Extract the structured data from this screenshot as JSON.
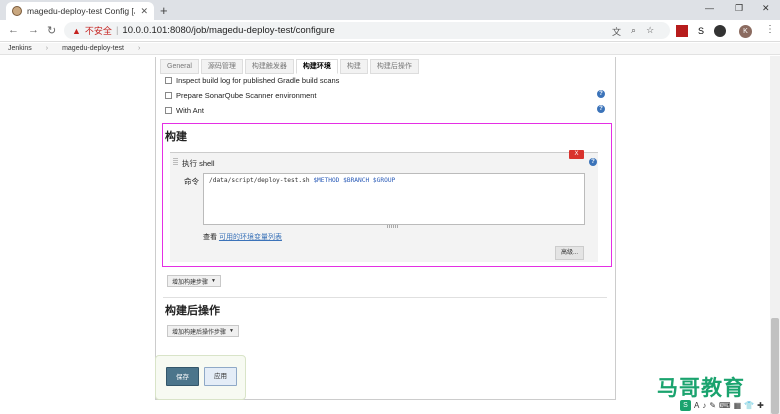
{
  "browser": {
    "tab_title": "magedu-deploy-test Config [J",
    "new_tab": "+",
    "window_controls": [
      "—",
      "❐",
      "✕"
    ],
    "insecure_label": "不安全",
    "url": "10.0.0.101:8080/job/magedu-deploy-test/configure",
    "avatar_letter": "K"
  },
  "breadcrumb": {
    "items": [
      "Jenkins",
      "magedu-deploy-test"
    ]
  },
  "config_tabs": [
    "General",
    "源码管理",
    "构建触发器",
    "构建环境",
    "构建",
    "构建后操作"
  ],
  "active_tab": "构建环境",
  "build_env_options": [
    "Inspect build log for published Gradle build scans",
    "Prepare SonarQube Scanner environment",
    "With Ant"
  ],
  "build_section": {
    "title": "构建",
    "step_title": "执行 shell",
    "delete_label": "X",
    "command_label": "命令",
    "command_path": "/data/script/deploy-test.sh",
    "command_vars": "$METHOD $BRANCH $GROUP",
    "env_prefix": "查看",
    "env_link": "可用的环境变量列表",
    "advanced_label": "高级..."
  },
  "add_build_step": "增加构建步骤",
  "post_build": {
    "title": "构建后操作",
    "add_label": "增加构建后操作步骤"
  },
  "actions": {
    "save": "保存",
    "apply": "应用"
  },
  "watermark": {
    "text": "马哥教育",
    "toolbar": [
      "S",
      "A",
      "♪",
      "✎",
      "⌨",
      "▦",
      "👕",
      "✚"
    ]
  },
  "colors": {
    "highlight_border": "#e42fe4",
    "save_button": "#4b758b",
    "delete_button": "#d9322c",
    "link": "#3b73b9",
    "watermark": "#1aa36e"
  }
}
